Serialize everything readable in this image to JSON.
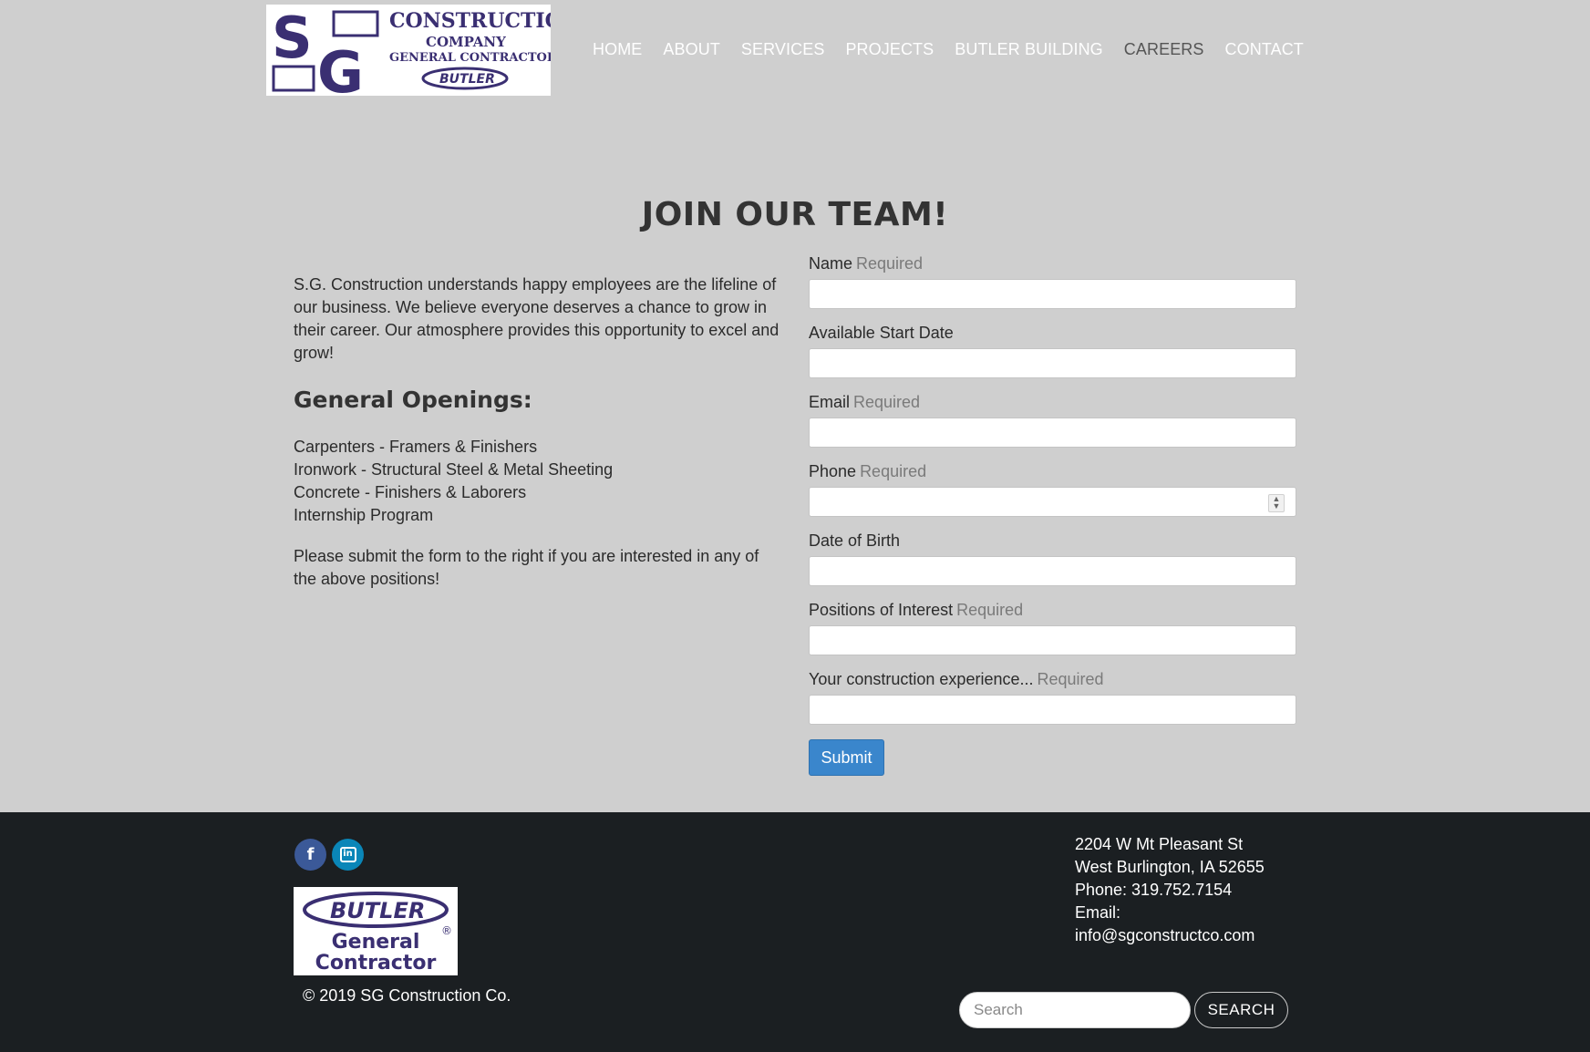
{
  "header": {
    "logo": {
      "line1": "CONSTRUCTION",
      "line2": "COMPANY",
      "line3": "GENERAL CONTRACTORS",
      "badge": "BUTLER",
      "initials": "SG"
    },
    "nav": [
      {
        "label": "HOME"
      },
      {
        "label": "ABOUT"
      },
      {
        "label": "SERVICES"
      },
      {
        "label": "PROJECTS"
      },
      {
        "label": "BUTLER BUILDING"
      },
      {
        "label": "CAREERS"
      },
      {
        "label": "CONTACT"
      }
    ]
  },
  "main": {
    "title": "JOIN OUR TEAM!",
    "intro": "S.G. Construction understands happy employees are the lifeline of our business. We believe everyone deserves a chance to grow in their career. Our atmosphere provides this opportunity to excel and grow!",
    "openings_title": "General Openings:",
    "openings": [
      "Carpenters - Framers & Finishers",
      "Ironwork - Structural Steel & Metal Sheeting",
      "Concrete - Finishers & Laborers",
      "Internship Program"
    ],
    "closing": "Please submit the form to the right if you are interested in any of the above positions!"
  },
  "form": {
    "required_label": "Required",
    "fields": [
      {
        "label": "Name",
        "required": "Required",
        "value": ""
      },
      {
        "label": "Available Start Date",
        "required": "",
        "value": ""
      },
      {
        "label": "Email",
        "required": "Required",
        "value": ""
      },
      {
        "label": "Phone",
        "required": "Required",
        "value": ""
      },
      {
        "label": "Date of Birth",
        "required": "",
        "value": ""
      },
      {
        "label": "Positions of Interest",
        "required": "Required",
        "value": ""
      },
      {
        "label": "Your construction experience...",
        "required": "Required",
        "value": ""
      }
    ],
    "submit_label": "Submit",
    "accent_color": "#3a86cc"
  },
  "footer": {
    "social": [
      {
        "icon": "facebook-icon",
        "glyph": "f"
      },
      {
        "icon": "linkedin-icon",
        "glyph": "in"
      }
    ],
    "butler_logo": {
      "badge": "BUTLER",
      "line1": "General",
      "line2": "Contractor"
    },
    "copyright": "© 2019 SG Construction Co.",
    "address": {
      "street": "2204 W Mt Pleasant St",
      "city": "West Burlington, IA 52655",
      "phone": "Phone: 319.752.7154",
      "email_label": "Email:",
      "email": "info@sgconstructco.com"
    },
    "search": {
      "placeholder": "Search",
      "button": "SEARCH"
    }
  }
}
